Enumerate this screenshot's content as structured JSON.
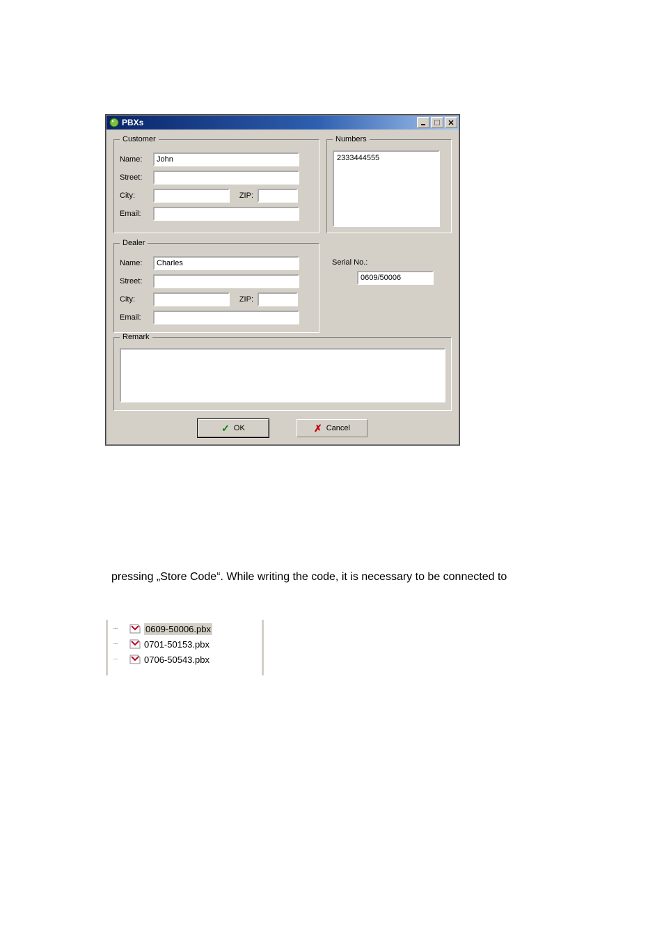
{
  "window": {
    "title": "PBXs"
  },
  "customer": {
    "legend": "Customer",
    "name_label": "Name:",
    "name_value": "John",
    "street_label": "Street:",
    "street_value": "",
    "city_label": "City:",
    "city_value": "",
    "zip_label": "ZIP:",
    "zip_value": "",
    "email_label": "Email:",
    "email_value": ""
  },
  "numbers": {
    "legend": "Numbers",
    "items": [
      "2333444555"
    ]
  },
  "dealer": {
    "legend": "Dealer",
    "name_label": "Name:",
    "name_value": "Charles",
    "street_label": "Street:",
    "street_value": "",
    "city_label": "City:",
    "city_value": "",
    "zip_label": "ZIP:",
    "zip_value": "",
    "email_label": "Email:",
    "email_value": ""
  },
  "serial": {
    "label": "Serial No.:",
    "value": "0609/50006"
  },
  "remark": {
    "legend": "Remark",
    "value": ""
  },
  "buttons": {
    "ok_label": "OK",
    "cancel_label": "Cancel"
  },
  "body_text": "pressing „Store Code“. While writing the code, it is necessary to be connected to",
  "tree": {
    "items": [
      {
        "label": "0609-50006.pbx",
        "selected": true
      },
      {
        "label": "0701-50153.pbx",
        "selected": false
      },
      {
        "label": "0706-50543.pbx",
        "selected": false
      }
    ]
  }
}
